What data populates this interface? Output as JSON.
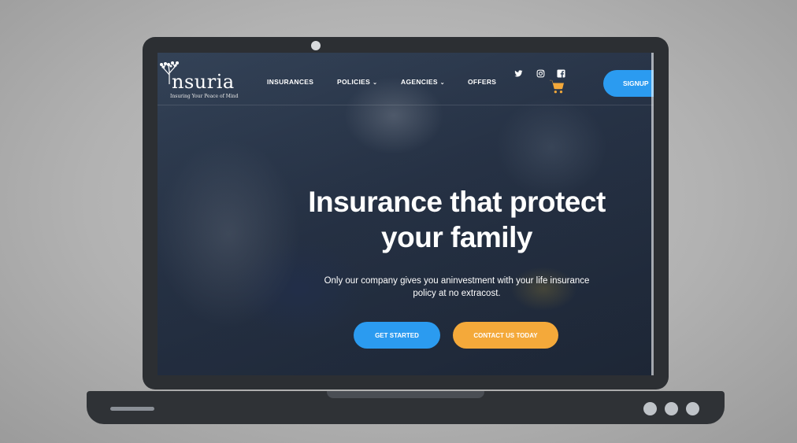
{
  "brand": {
    "name": "nsuria",
    "tagline": "Insuring Your Peace of Mind"
  },
  "nav": {
    "items": [
      {
        "label": "INSURANCES",
        "has_dropdown": false
      },
      {
        "label": "POLICIES",
        "has_dropdown": true
      },
      {
        "label": "AGENCIES",
        "has_dropdown": true
      },
      {
        "label": "OFFERS",
        "has_dropdown": false
      }
    ],
    "dropdown_glyph": "⌄",
    "social_icons": [
      "twitter-icon",
      "instagram-icon",
      "facebook-icon"
    ],
    "cart_icon": "cart-icon",
    "signup_label": "SIGNUP"
  },
  "hero": {
    "headline_line1": "Insurance that protect",
    "headline_line2": "your family",
    "subtext_line1": "Only our company gives you aninvestment with your life insurance",
    "subtext_line2": "policy at no extracost.",
    "primary_cta": "GET STARTED",
    "secondary_cta": "CONTACT US TODAY"
  },
  "colors": {
    "accent_blue": "#2b9bf0",
    "accent_orange": "#f4a93a",
    "laptop_frame": "#2c2f33"
  }
}
